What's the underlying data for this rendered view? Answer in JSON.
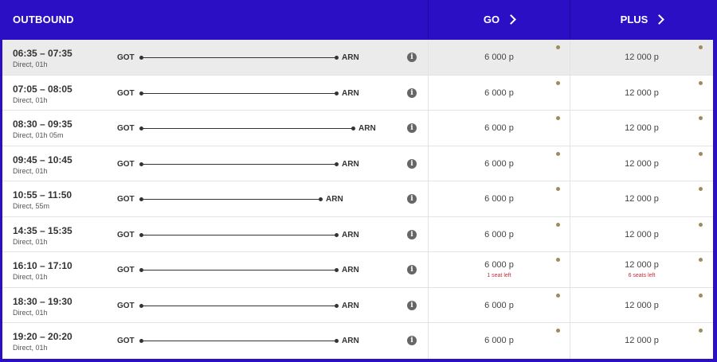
{
  "header": {
    "outbound_label": "OUTBOUND",
    "go_label": "GO",
    "plus_label": "PLUS"
  },
  "colors": {
    "header_bg": "#2b0fc4",
    "selected_row": "#ebebeb",
    "seat_warning": "#c03040",
    "fare_dot": "#a08a5c"
  },
  "icons": {
    "column_chevron": "chevron-right-icon",
    "info": "info-icon"
  },
  "flights": [
    {
      "time": "06:35 – 07:35",
      "duration": "Direct, 01h",
      "from": "GOT",
      "to": "ARN",
      "go_price": "6 000 р",
      "plus_price": "12 000 р",
      "go_seats": "",
      "plus_seats": ""
    },
    {
      "time": "07:05 – 08:05",
      "duration": "Direct, 01h",
      "from": "GOT",
      "to": "ARN",
      "go_price": "6 000 р",
      "plus_price": "12 000 р",
      "go_seats": "",
      "plus_seats": ""
    },
    {
      "time": "08:30 – 09:35",
      "duration": "Direct, 01h 05m",
      "from": "GOT",
      "to": "ARN",
      "go_price": "6 000 р",
      "plus_price": "12 000 р",
      "go_seats": "",
      "plus_seats": ""
    },
    {
      "time": "09:45 – 10:45",
      "duration": "Direct, 01h",
      "from": "GOT",
      "to": "ARN",
      "go_price": "6 000 р",
      "plus_price": "12 000 р",
      "go_seats": "",
      "plus_seats": ""
    },
    {
      "time": "10:55 – 11:50",
      "duration": "Direct, 55m",
      "from": "GOT",
      "to": "ARN",
      "go_price": "6 000 р",
      "plus_price": "12 000 р",
      "go_seats": "",
      "plus_seats": ""
    },
    {
      "time": "14:35 – 15:35",
      "duration": "Direct, 01h",
      "from": "GOT",
      "to": "ARN",
      "go_price": "6 000 р",
      "plus_price": "12 000 р",
      "go_seats": "",
      "plus_seats": ""
    },
    {
      "time": "16:10 – 17:10",
      "duration": "Direct, 01h",
      "from": "GOT",
      "to": "ARN",
      "go_price": "6 000 р",
      "plus_price": "12 000 р",
      "go_seats": "1 seat left",
      "plus_seats": "6 seats left"
    },
    {
      "time": "18:30 – 19:30",
      "duration": "Direct, 01h",
      "from": "GOT",
      "to": "ARN",
      "go_price": "6 000 р",
      "plus_price": "12 000 р",
      "go_seats": "",
      "plus_seats": ""
    },
    {
      "time": "19:20 – 20:20",
      "duration": "Direct, 01h",
      "from": "GOT",
      "to": "ARN",
      "go_price": "6 000 р",
      "plus_price": "12 000 р",
      "go_seats": "",
      "plus_seats": ""
    }
  ]
}
